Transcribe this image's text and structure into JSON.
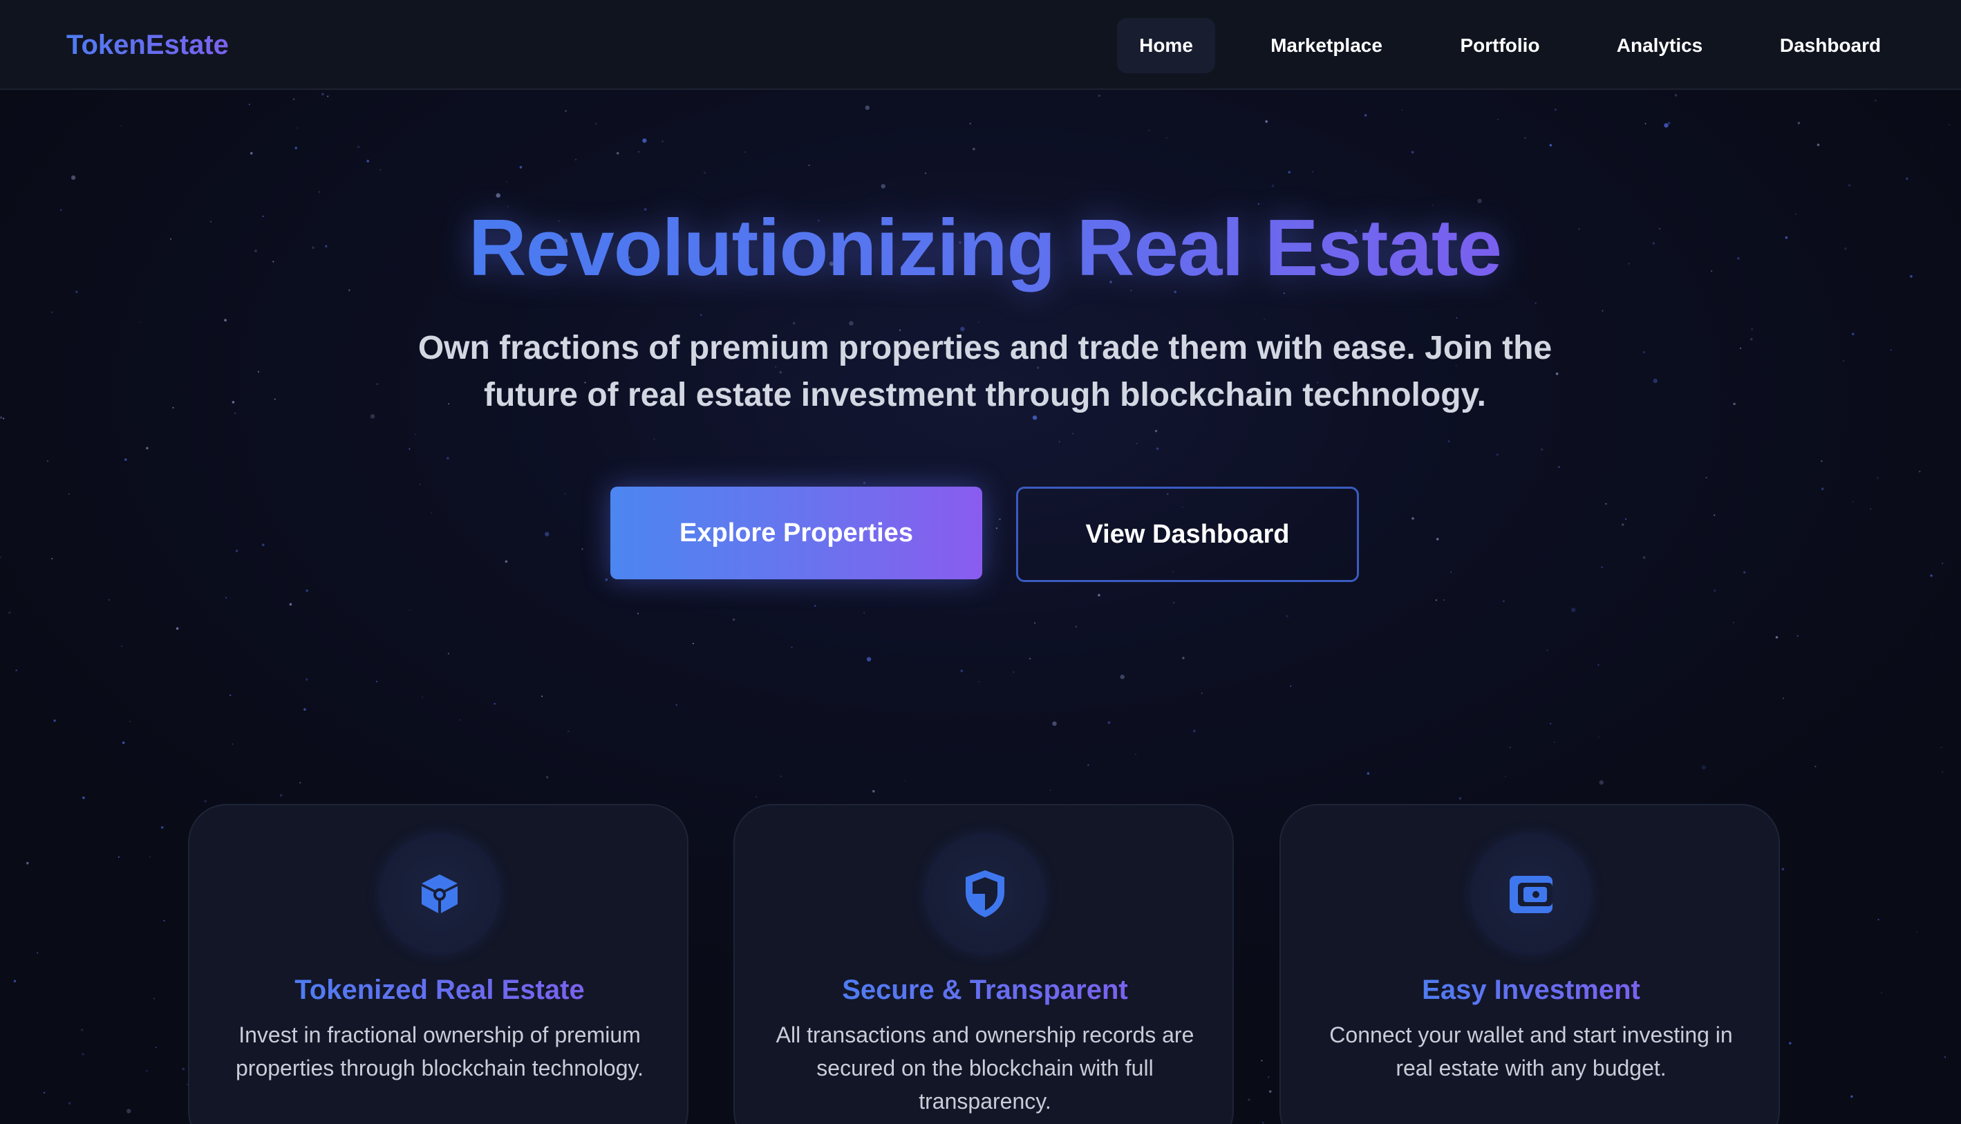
{
  "navbar": {
    "brand": "TokenEstate",
    "items": [
      {
        "label": "Home",
        "active": true
      },
      {
        "label": "Marketplace",
        "active": false
      },
      {
        "label": "Portfolio",
        "active": false
      },
      {
        "label": "Analytics",
        "active": false
      },
      {
        "label": "Dashboard",
        "active": false
      }
    ]
  },
  "hero": {
    "title": "Revolutionizing Real Estate",
    "subtitle": "Own fractions of premium properties and trade them with ease. Join the future of real estate investment through blockchain technology.",
    "primary_button": "Explore Properties",
    "secondary_button": "View Dashboard"
  },
  "features": [
    {
      "icon": "cube-icon",
      "title": "Tokenized Real Estate",
      "text": "Invest in fractional ownership of premium properties through blockchain technology."
    },
    {
      "icon": "shield-icon",
      "title": "Secure & Transparent",
      "text": "All transactions and ownership records are secured on the blockchain with full transparency."
    },
    {
      "icon": "wallet-icon",
      "title": "Easy Investment",
      "text": "Connect your wallet and start investing in real estate with any budget."
    }
  ],
  "colors": {
    "background": "#0b0d1a",
    "navbar": "#10141f",
    "accent_blue": "#4f7cf2",
    "accent_purple": "#7b62ee",
    "card": "#121627",
    "secondary_border": "#3a5bc0"
  }
}
